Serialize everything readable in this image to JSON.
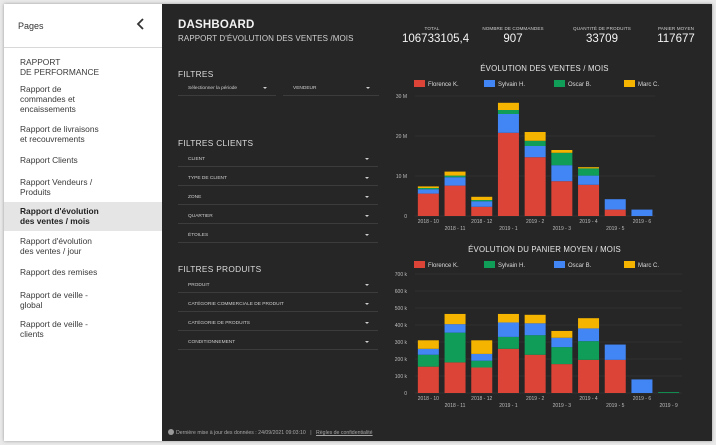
{
  "sidebar": {
    "title": "Pages",
    "items": [
      {
        "label": "RAPPORT\nDE PERFORMANCE",
        "active": false
      },
      {
        "label": "Rapport de\ncommandes et\nencaissements",
        "active": false
      },
      {
        "label": "Rapport de livraisons\net recouvrements",
        "active": false
      },
      {
        "label": "Rapport Clients",
        "active": false
      },
      {
        "label": "Rapport Vendeurs /\nProduits",
        "active": false
      },
      {
        "label": "Rapport d'évolution\ndes ventes / mois",
        "active": true
      },
      {
        "label": "Rapport d'évolution\ndes ventes / jour",
        "active": false
      },
      {
        "label": "Rapport des remises",
        "active": false
      },
      {
        "label": "Rapport de veille -\nglobal",
        "active": false
      },
      {
        "label": "Rapport de veille -\nclients",
        "active": false
      }
    ]
  },
  "header": {
    "title": "DASHBOARD",
    "subtitle": "RAPPORT D'ÉVOLUTION DES VENTES /MOIS"
  },
  "kpis": [
    {
      "label": "TOTAL",
      "value": "106733105,4"
    },
    {
      "label": "NOMBRE DE COMMANDES",
      "value": "907"
    },
    {
      "label": "QUANTITÉ DE PRODUITS",
      "value": "33709"
    },
    {
      "label": "PANIER MOYEN",
      "value": "117677"
    }
  ],
  "filters": {
    "title": "FILTRES",
    "period": "Sélectionner la période",
    "seller": "VENDEUR"
  },
  "client_filters": {
    "title": "FILTRES CLIENTS",
    "items": [
      "CLIENT",
      "TYPE DE CLIENT",
      "ZONE",
      "QUARTIER",
      "ÉTOILES"
    ]
  },
  "product_filters": {
    "title": "FILTRES PRODUITS",
    "items": [
      "PRODUIT",
      "CATÉGORIE COMMERCIALE DE PRODUIT",
      "CATÉGORIE DE PRODUITS",
      "CONDITIONNEMENT"
    ]
  },
  "colors": {
    "florence": "#db4437",
    "sylvain": "#4285f4",
    "oscar": "#0f9d58",
    "marc": "#f4b400"
  },
  "chart_data": [
    {
      "type": "bar",
      "title": "ÉVOLUTION DES VENTES / MOIS",
      "stacked": true,
      "categories": [
        "2018 - 10",
        "2018 - 11",
        "2018 - 12",
        "2019 - 1",
        "2019 - 2",
        "2019 - 3",
        "2019 - 4",
        "2019 - 5",
        "2019 - 6"
      ],
      "yticks": [
        "0",
        "10 M",
        "20 M",
        "30 M"
      ],
      "ylim": [
        0,
        30
      ],
      "series": [
        {
          "name": "Florence K.",
          "color": "#db4437",
          "values": [
            5.6,
            7.6,
            2.3,
            20.8,
            14.7,
            8.7,
            7.8,
            1.6,
            0
          ]
        },
        {
          "name": "Sylvain H.",
          "color": "#4285f4",
          "values": [
            1.1,
            2.1,
            1.4,
            4.7,
            2.8,
            4.0,
            2.3,
            2.6,
            1.6
          ]
        },
        {
          "name": "Oscar B.",
          "color": "#0f9d58",
          "values": [
            0.3,
            0.4,
            0.3,
            1.0,
            1.3,
            3.1,
            1.8,
            0,
            0
          ]
        },
        {
          "name": "Marc C.",
          "color": "#f4b400",
          "values": [
            0.4,
            1.0,
            0.8,
            1.8,
            2.2,
            0.7,
            0.3,
            0,
            0
          ]
        }
      ]
    },
    {
      "type": "bar",
      "title": "ÉVOLUTION DU PANIER MOYEN / MOIS",
      "stacked": true,
      "categories": [
        "2018 - 10",
        "2018 - 11",
        "2018 - 12",
        "2019 - 1",
        "2019 - 2",
        "2019 - 3",
        "2019 - 4",
        "2019 - 5",
        "2019 - 6",
        "2019 - 9"
      ],
      "yticks": [
        "0",
        "100 k",
        "200 k",
        "300 k",
        "400 k",
        "500 k",
        "600 k",
        "700 k"
      ],
      "ylim": [
        0,
        700
      ],
      "series": [
        {
          "name": "Florence K.",
          "color": "#db4437",
          "values": [
            155,
            180,
            150,
            260,
            225,
            170,
            195,
            195,
            0,
            0
          ]
        },
        {
          "name": "Sylvain H.",
          "color": "#0f9d58",
          "values": [
            70,
            175,
            40,
            70,
            115,
            100,
            110,
            0,
            0,
            5
          ]
        },
        {
          "name": "Oscar B.",
          "color": "#4285f4",
          "values": [
            35,
            50,
            40,
            85,
            70,
            55,
            75,
            90,
            80,
            0
          ]
        },
        {
          "name": "Marc C.",
          "color": "#f4b400",
          "values": [
            50,
            60,
            80,
            50,
            50,
            40,
            60,
            0,
            0,
            0
          ]
        }
      ]
    }
  ],
  "footer": {
    "updated": "Dernière mise à jour des données : 24/09/2021 09:03:10",
    "separator": "|",
    "privacy": "Règles de confidentialité"
  }
}
